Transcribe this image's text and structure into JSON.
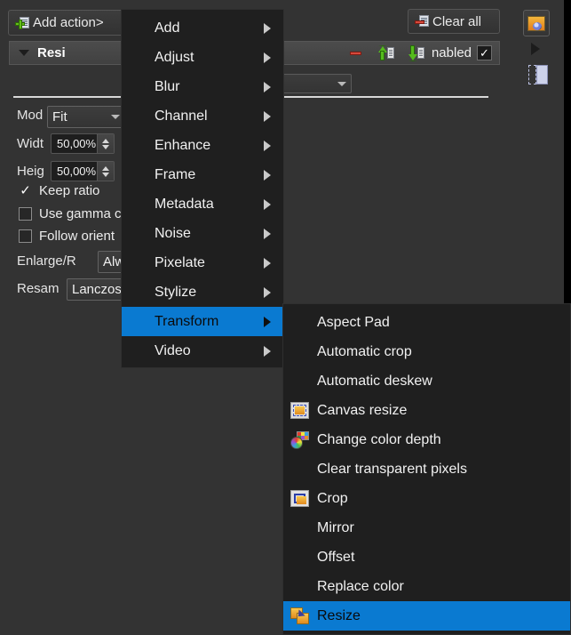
{
  "app": {
    "accent_blue": "#0a7ad1",
    "panel_bg": "#333333",
    "menu_bg": "#1f1f1f"
  },
  "toolbar": {
    "add_action_label": "Add action>",
    "clear_all_label": "Clear all",
    "add_action_icon": "add-action-icon",
    "clear_all_icon": "clear-all-icon"
  },
  "action": {
    "title": "Resi",
    "full_title": "Resize",
    "collapse_icon": "triangle-down-icon",
    "remove_icon": "remove-icon",
    "move_up_icon": "move-up-icon",
    "move_down_icon": "move-down-icon",
    "enabled_label": "nabled",
    "enabled_checked": "✓",
    "top_combo_value": ""
  },
  "form": {
    "mode": {
      "label": "Mod",
      "full_label": "Mode",
      "value": "Fit"
    },
    "width": {
      "label": "Widt",
      "full_label": "Width",
      "value": "50,00%"
    },
    "height": {
      "label": "Heig",
      "full_label": "Height",
      "value": "50,00%"
    },
    "keep_ratio": {
      "label": "Keep ratio",
      "checked": true,
      "check_glyph": "✓"
    },
    "use_gamma": {
      "label": "Use gamma c",
      "full_label": "Use gamma correction",
      "checked": false
    },
    "follow_orientation": {
      "label": "Follow orient",
      "full_label": "Follow orientation",
      "checked": false
    },
    "enlarge_reduce": {
      "label": "Enlarge/R",
      "full_label": "Enlarge/Reduce",
      "value": "Alwa"
    },
    "resample": {
      "label": "Resam",
      "full_label": "Resampling",
      "value": "Lanczos"
    }
  },
  "menu_actions": {
    "items": [
      {
        "label": "Add",
        "has_submenu": true,
        "selected": false,
        "icon": null
      },
      {
        "label": "Adjust",
        "has_submenu": true,
        "selected": false,
        "icon": null
      },
      {
        "label": "Blur",
        "has_submenu": true,
        "selected": false,
        "icon": null
      },
      {
        "label": "Channel",
        "has_submenu": true,
        "selected": false,
        "icon": null
      },
      {
        "label": "Enhance",
        "has_submenu": true,
        "selected": false,
        "icon": null
      },
      {
        "label": "Frame",
        "has_submenu": true,
        "selected": false,
        "icon": null
      },
      {
        "label": "Metadata",
        "has_submenu": true,
        "selected": false,
        "icon": null
      },
      {
        "label": "Noise",
        "has_submenu": true,
        "selected": false,
        "icon": null
      },
      {
        "label": "Pixelate",
        "has_submenu": true,
        "selected": false,
        "icon": null
      },
      {
        "label": "Stylize",
        "has_submenu": true,
        "selected": false,
        "icon": null
      },
      {
        "label": "Transform",
        "has_submenu": true,
        "selected": true,
        "icon": null
      },
      {
        "label": "Video",
        "has_submenu": true,
        "selected": false,
        "icon": null
      }
    ]
  },
  "menu_transform": {
    "items": [
      {
        "label": "Aspect Pad",
        "selected": false,
        "icon": null
      },
      {
        "label": "Automatic crop",
        "selected": false,
        "icon": null
      },
      {
        "label": "Automatic deskew",
        "selected": false,
        "icon": null
      },
      {
        "label": "Canvas resize",
        "selected": false,
        "icon": "canvas-resize-icon"
      },
      {
        "label": "Change color depth",
        "selected": false,
        "icon": "color-depth-icon"
      },
      {
        "label": "Clear transparent pixels",
        "selected": false,
        "icon": null
      },
      {
        "label": "Crop",
        "selected": false,
        "icon": "crop-icon"
      },
      {
        "label": "Mirror",
        "selected": false,
        "icon": null
      },
      {
        "label": "Offset",
        "selected": false,
        "icon": null
      },
      {
        "label": "Replace color",
        "selected": false,
        "icon": null
      },
      {
        "label": "Resize",
        "selected": true,
        "icon": "resize-icon"
      }
    ]
  },
  "dock": {
    "thumbnail_icon": "image-preview-icon",
    "expand_icon": "expand-arrow-icon",
    "panel_icon": "panel-toggle-icon"
  }
}
